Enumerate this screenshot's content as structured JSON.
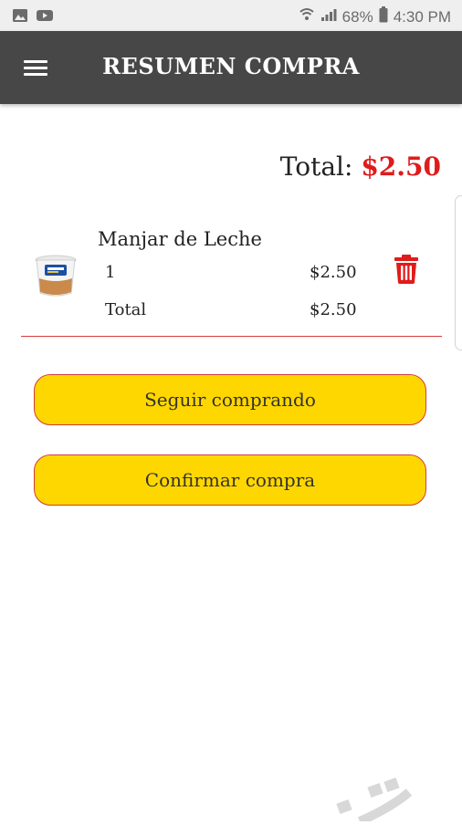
{
  "status_bar": {
    "battery": "68%",
    "time": "4:30 PM"
  },
  "app_bar": {
    "title": "RESUMEN COMPRA"
  },
  "summary": {
    "total_label": "Total:",
    "total_amount": "$2.50"
  },
  "cart": {
    "items": [
      {
        "name": "Manjar de Leche",
        "quantity": "1",
        "unit_price": "$2.50",
        "total_label": "Total",
        "total_value": "$2.50"
      }
    ]
  },
  "actions": {
    "continue_label": "Seguir comprando",
    "confirm_label": "Confirmar compra"
  },
  "colors": {
    "app_bar": "#474747",
    "accent_red": "#e01b1b",
    "button_yellow": "#ffd700"
  },
  "icons": [
    "image-icon",
    "youtube-icon",
    "wifi-icon",
    "signal-icon",
    "battery-icon",
    "menu-icon",
    "trash-icon"
  ]
}
